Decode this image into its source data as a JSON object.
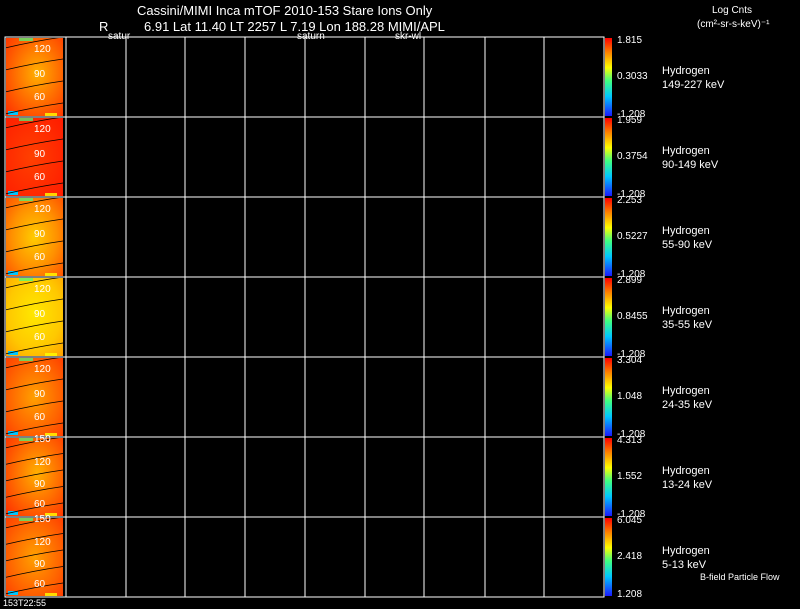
{
  "header": {
    "title": "Cassini/MIMI Inca mTOF  2010-153   Stare   Ions Only",
    "r_label": "R",
    "position_line": "6.91 Lat 11.40 LT 2257 L      7.19 Lon      188.28  MIMI/APL",
    "marker_left": "satur",
    "marker_mid": "saturn",
    "marker_right": "skr-wl",
    "units_title": "Log Cnts",
    "units": "(cm²-sr-s-keV)⁻¹"
  },
  "footer": {
    "time": "153T22:55",
    "note": "B-field Particle Flow"
  },
  "colors": {
    "background": "#000000",
    "grid": "#ffffff",
    "colormap": [
      "#1a1aff",
      "#00c8ff",
      "#40ff80",
      "#ffff00",
      "#ff8000",
      "#ff0000"
    ]
  },
  "chart_data": {
    "type": "heatmap",
    "title": "Cassini/MIMI Inca mTOF  2010-153   Stare   Ions Only",
    "columns": 9,
    "grid": true,
    "y_ticks": [
      "150",
      "120",
      "90",
      "60"
    ],
    "panels": [
      {
        "species": "Hydrogen",
        "energy": "149-227 keV",
        "cb_max": "1.815",
        "cb_mid": "0.3033",
        "cb_min": "-1.208",
        "ticks": [
          "120",
          "90",
          "60"
        ]
      },
      {
        "species": "Hydrogen",
        "energy": "90-149 keV",
        "cb_max": "1.959",
        "cb_mid": "0.3754",
        "cb_min": "-1.208",
        "ticks": [
          "120",
          "90",
          "60"
        ]
      },
      {
        "species": "Hydrogen",
        "energy": "55-90 keV",
        "cb_max": "2.253",
        "cb_mid": "0.5227",
        "cb_min": "-1.208",
        "ticks": [
          "120",
          "90",
          "60"
        ]
      },
      {
        "species": "Hydrogen",
        "energy": "35-55 keV",
        "cb_max": "2.899",
        "cb_mid": "0.8455",
        "cb_min": "-1.208",
        "ticks": [
          "120",
          "90",
          "60"
        ]
      },
      {
        "species": "Hydrogen",
        "energy": "24-35 keV",
        "cb_max": "3.304",
        "cb_mid": "1.048",
        "cb_min": "-1.208",
        "ticks": [
          "120",
          "90",
          "60"
        ]
      },
      {
        "species": "Hydrogen",
        "energy": "13-24 keV",
        "cb_max": "4.313",
        "cb_mid": "1.552",
        "cb_min": "-1.208",
        "ticks": [
          "150",
          "120",
          "90",
          "60"
        ]
      },
      {
        "species": "Hydrogen",
        "energy": "5-13 keV",
        "cb_max": "6.045",
        "cb_mid": "2.418",
        "cb_min": "1.208",
        "ticks": [
          "150",
          "120",
          "90",
          "60"
        ]
      }
    ]
  }
}
